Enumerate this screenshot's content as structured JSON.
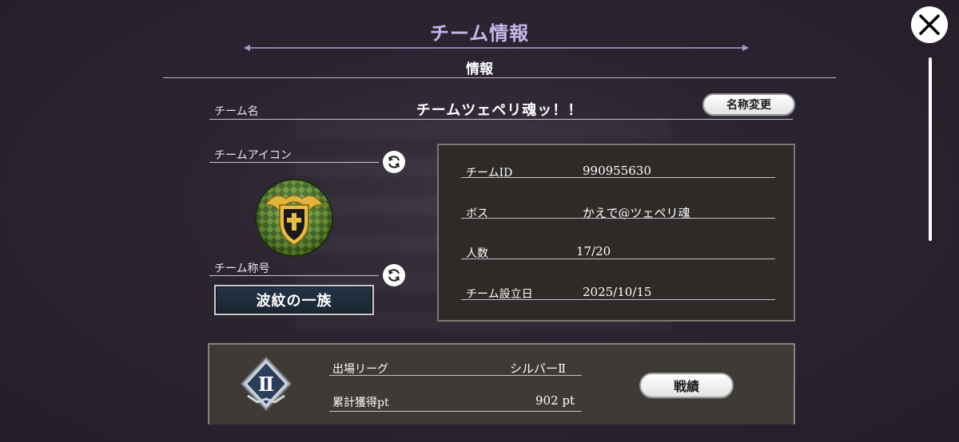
{
  "header": {
    "title": "チーム情報",
    "subtitle": "情報"
  },
  "team": {
    "name_label": "チーム名",
    "name": "チームツェペリ魂ッ！！",
    "rename_button": "名称変更",
    "icon_label": "チームアイコン",
    "title_label": "チーム称号",
    "title_value": "波紋の一族"
  },
  "info": {
    "rows": [
      {
        "label": "チームID",
        "value": "990955630"
      },
      {
        "label": "ボス",
        "value": "かえで@ツェペリ魂"
      },
      {
        "label": "人数",
        "value": "17/20"
      },
      {
        "label": "チーム設立日",
        "value": "2025/10/15"
      }
    ]
  },
  "league": {
    "league_label": "出場リーグ",
    "league_value": "シルバーⅡ",
    "points_label": "累計獲得pt",
    "points_value": "902 pt",
    "results_button": "戦績",
    "rank_badge": "Ⅱ"
  },
  "icons": {
    "close": "close-icon",
    "refresh": "refresh-icon",
    "emblem": "shield-cross-emblem-icon",
    "league": "silver-league-badge-icon"
  },
  "colors": {
    "header_title": "#c7b8ea",
    "background": "#2a2230",
    "info_box": "#2d2a28",
    "league_box": "#3e3a36"
  }
}
